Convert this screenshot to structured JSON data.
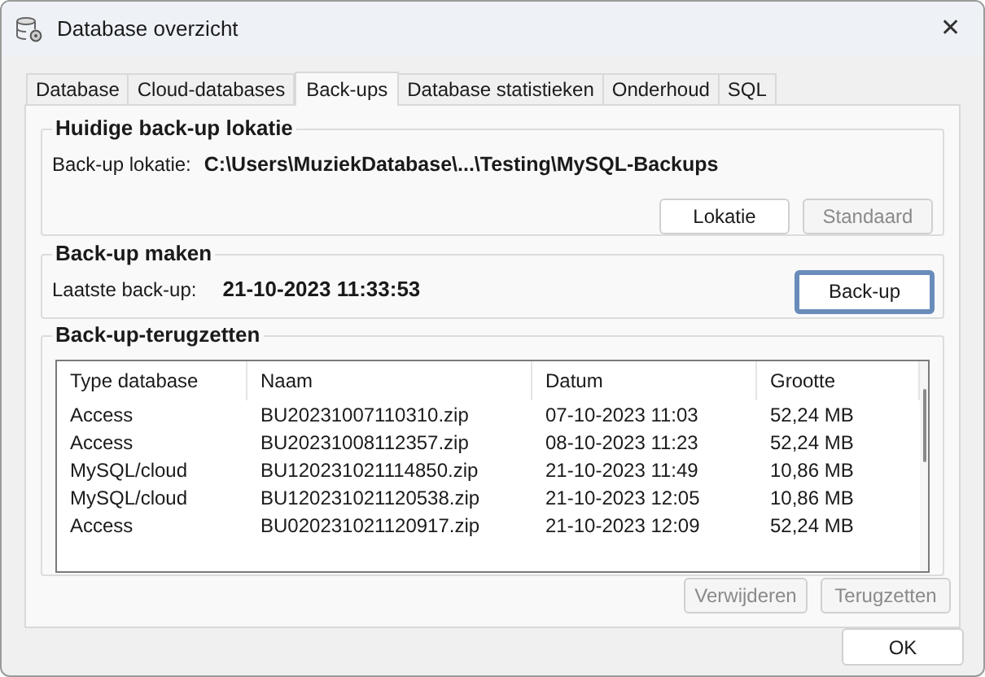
{
  "window": {
    "title": "Database overzicht",
    "close": "✕"
  },
  "tabs": [
    {
      "label": "Database",
      "selected": false
    },
    {
      "label": "Cloud-databases",
      "selected": false
    },
    {
      "label": "Back-ups",
      "selected": true
    },
    {
      "label": "Database statistieken",
      "selected": false
    },
    {
      "label": "Onderhoud",
      "selected": false
    },
    {
      "label": "SQL",
      "selected": false
    }
  ],
  "location_group": {
    "title": "Huidige back-up lokatie",
    "label": "Back-up lokatie:",
    "value": "C:\\Users\\MuziekDatabase\\...\\Testing\\MySQL-Backups",
    "buttons": [
      {
        "label": "Lokatie",
        "disabled": false,
        "focused": false
      },
      {
        "label": "Standaard",
        "disabled": true,
        "focused": false
      }
    ]
  },
  "backup_group": {
    "title": "Back-up maken",
    "label": "Laatste back-up:",
    "value": "21-10-2023 11:33:53",
    "button": {
      "label": "Back-up",
      "disabled": false,
      "focused": true
    }
  },
  "restore_group": {
    "title": "Back-up-terugzetten",
    "table": {
      "columns": [
        "Type database",
        "Naam",
        "Datum",
        "Grootte"
      ],
      "rows": [
        [
          "Access",
          "BU20231007110310.zip",
          "07-10-2023 11:03",
          "52,24 MB"
        ],
        [
          "Access",
          "BU20231008112357.zip",
          "08-10-2023 11:23",
          "52,24 MB"
        ],
        [
          "MySQL/cloud",
          "BU120231021114850.zip",
          "21-10-2023 11:49",
          "10,86 MB"
        ],
        [
          "MySQL/cloud",
          "BU120231021120538.zip",
          "21-10-2023 12:05",
          "10,86 MB"
        ],
        [
          "Access",
          "BU020231021120917.zip",
          "21-10-2023 12:09",
          "52,24 MB"
        ]
      ]
    },
    "buttons": [
      {
        "label": "Verwijderen",
        "disabled": true,
        "focused": false
      },
      {
        "label": "Terugzetten",
        "disabled": true,
        "focused": false
      }
    ]
  },
  "footer_button": {
    "label": "OK",
    "disabled": false,
    "focused": false
  }
}
